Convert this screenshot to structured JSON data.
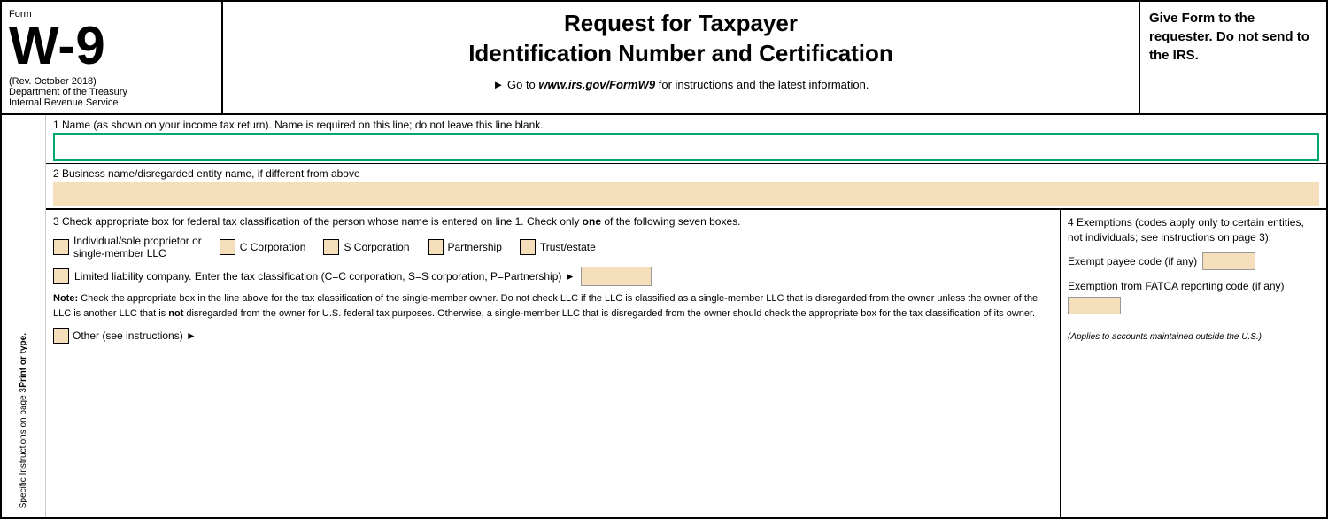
{
  "header": {
    "form_label": "Form",
    "w9_title": "W-9",
    "rev": "(Rev. October 2018)",
    "dept1": "Department of the Treasury",
    "dept2": "Internal Revenue Service",
    "main_title_line1": "Request for Taxpayer",
    "main_title_line2": "Identification Number and Certification",
    "goto_prefix": "► Go to ",
    "goto_url": "www.irs.gov/FormW9",
    "goto_suffix": " for instructions and the latest information.",
    "right_text": "Give Form to the requester. Do not send to the IRS."
  },
  "line1": {
    "label": "1  Name (as shown on your income tax return). Name is required on this line; do not leave this line blank.",
    "value": ""
  },
  "line2": {
    "label": "2  Business name/disregarded entity name, if different from above",
    "value": ""
  },
  "line3": {
    "label_prefix": "3  Check appropriate box for federal tax classification of the person whose name is entered on line 1. Check only ",
    "label_bold": "one",
    "label_suffix": " of the following seven boxes.",
    "checkboxes": [
      {
        "id": "individual",
        "label": "Individual/sole proprietor or\nsingle-member LLC"
      },
      {
        "id": "c-corp",
        "label": "C Corporation"
      },
      {
        "id": "s-corp",
        "label": "S Corporation"
      },
      {
        "id": "partnership",
        "label": "Partnership"
      },
      {
        "id": "trust",
        "label": "Trust/estate"
      }
    ],
    "llc_label": "Limited liability company. Enter the tax classification (C=C corporation, S=S corporation, P=Partnership) ►",
    "note_label": "Note:",
    "note_text": " Check the appropriate box in the line above for the tax classification of the single-member owner.  Do not check LLC if the LLC is classified as a single-member LLC that is disregarded from the owner unless the owner of the LLC is another LLC that is ",
    "note_bold": "not",
    "note_text2": " disregarded from the owner for U.S. federal tax purposes. Otherwise, a single-member LLC that is disregarded from the owner should check the appropriate box for the tax classification of its owner.",
    "other_label": "Other (see instructions) ►"
  },
  "line4": {
    "title": "4  Exemptions (codes apply only to certain entities, not individuals; see instructions on page 3):",
    "exempt_payee_label": "Exempt payee code (if any)",
    "fatca_label": "Exemption from FATCA reporting code (if any)",
    "applies_note": "(Applies to accounts maintained outside the U.S.)"
  },
  "side_text": {
    "line1": "Print or type.",
    "line2": "Specific Instructions on page 3"
  }
}
